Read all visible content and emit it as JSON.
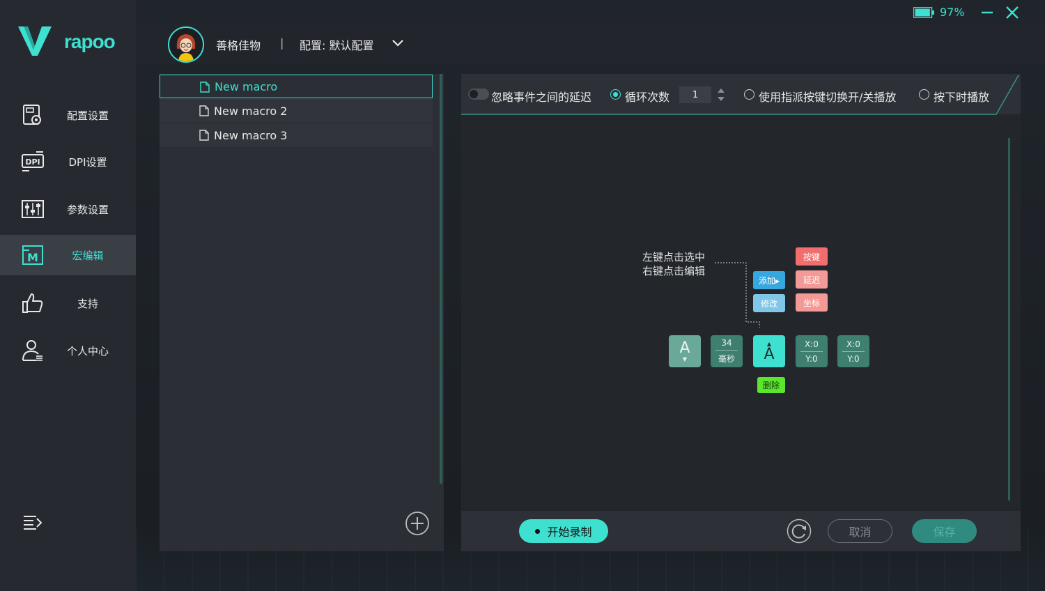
{
  "brand": {
    "name": "rapoo"
  },
  "colors": {
    "accent": "#3ee0d0",
    "sidebar_bg": "#262a30",
    "panel_bg": "#2b2f35"
  },
  "window": {
    "battery_percent": "97%",
    "battery_level": 0.97
  },
  "header": {
    "username": "善格佳物",
    "separator": "|",
    "profile": "配置: 默认配置"
  },
  "sidebar": {
    "items": [
      {
        "label": "配置设置",
        "icon": "profile-settings-icon"
      },
      {
        "label": "DPI设置",
        "icon": "dpi-icon"
      },
      {
        "label": "参数设置",
        "icon": "sliders-icon"
      },
      {
        "label": "宏编辑",
        "icon": "macro-icon",
        "active": true
      },
      {
        "label": "支持",
        "icon": "thumbs-up-icon"
      },
      {
        "label": "个人中心",
        "icon": "user-icon"
      }
    ]
  },
  "macros": {
    "items": [
      {
        "label": "New macro",
        "active": true
      },
      {
        "label": "New macro 2"
      },
      {
        "label": "New macro 3"
      }
    ]
  },
  "toolbar": {
    "ignore_delay_label": "忽略事件之间的延迟",
    "loop_label": "循环次数",
    "loop_count": "1",
    "toggle_label": "使用指派按键切换开/关播放",
    "hold_label": "按下时播放"
  },
  "guide": {
    "hint_line1": "左键点击选中",
    "hint_line2": "右键点击编辑",
    "add_label": "添加▸",
    "modify_label": "修改",
    "key_label": "按键",
    "delay_label": "延迟",
    "coord_label": "坐标",
    "delete_label": "删除",
    "cards": {
      "key_down": "A",
      "delay_value": "34",
      "delay_unit": "毫秒",
      "key_up": "A",
      "x1": "X:0",
      "y1": "Y:0",
      "x2": "X:0",
      "y2": "Y:0"
    }
  },
  "footer": {
    "record_label": "开始录制",
    "cancel_label": "取消",
    "save_label": "保存"
  }
}
